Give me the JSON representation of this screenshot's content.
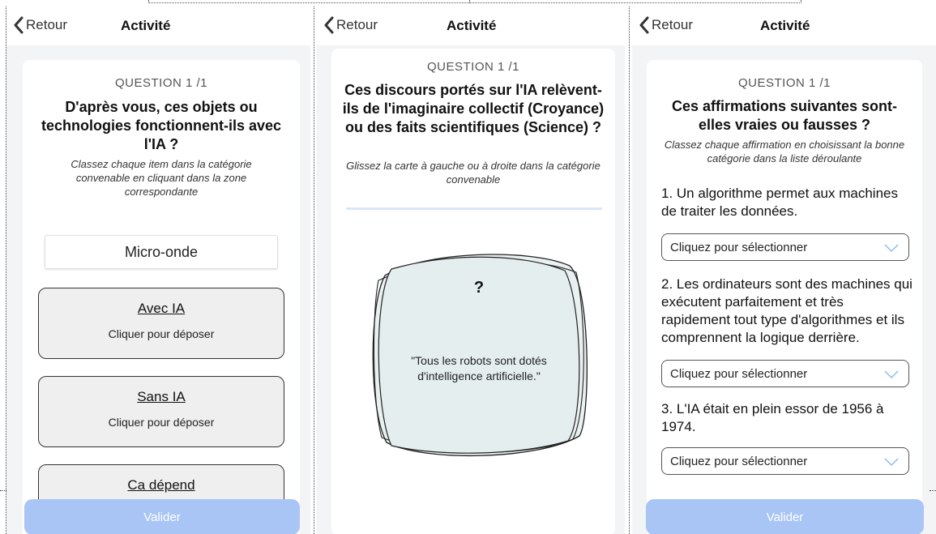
{
  "common": {
    "back_label": "Retour",
    "title": "Activité",
    "question_number": "QUESTION 1 /1",
    "validate_label": "Valider",
    "accent": "#a9c5f5"
  },
  "screen1": {
    "question": "D'après vous, ces objets ou technologies fonctionnent-ils avec l'IA ?",
    "instructions": "Classez chaque item dans la catégorie convenable en cliquant dans la zone correspondante",
    "item": "Micro-onde",
    "zones": [
      {
        "title": "Avec IA",
        "hint": "Cliquer pour déposer"
      },
      {
        "title": "Sans IA",
        "hint": "Cliquer pour déposer"
      },
      {
        "title": "Ca dépend"
      }
    ]
  },
  "screen2": {
    "question": "Ces discours portés sur l'IA relèvent-ils de l'imaginaire collectif (Croyance) ou des faits scientifiques (Science) ?",
    "instructions": "Glissez la carte à gauche ou à droite dans la catégorie convenable",
    "card_mark": "?",
    "card_text": "\"Tous les robots sont dotés d'intelligence artificielle.\""
  },
  "screen3": {
    "question": "Ces affirmations suivantes sont-elles vraies ou fausses ?",
    "instructions": "Classez chaque affirmation en choisissant la bonne catégorie dans la liste déroulante",
    "statements": [
      {
        "text": "1. Un algorithme permet aux machines de traiter les données.",
        "select": "Cliquez pour sélectionner"
      },
      {
        "text": "2. Les ordinateurs sont des machines qui exécutent parfaitement et très rapidement tout type d'algorithmes et ils comprennent la logique derrière.",
        "select": "Cliquez pour sélectionner"
      },
      {
        "text": "3. L'IA était en plein essor de 1956 à 1974.",
        "select": "Cliquez pour sélectionner"
      }
    ]
  }
}
